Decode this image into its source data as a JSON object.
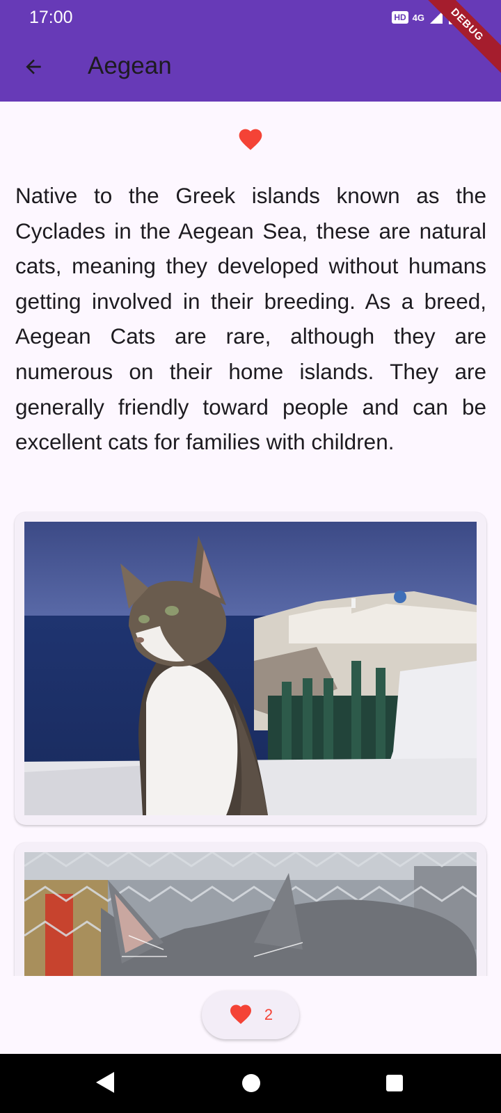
{
  "status_bar": {
    "time": "17:00",
    "hd_badge": "HD",
    "network": "4G"
  },
  "debug_banner": "DEBUG",
  "app_bar": {
    "title": "Aegean",
    "back_icon": "arrow-back-icon"
  },
  "favorite": {
    "icon": "heart-icon",
    "color": "#f44336"
  },
  "description": "Native to the Greek islands known as the Cyclades in the Aegean Sea, these are natural cats, meaning they developed without humans getting involved in their breeding. As a breed, Aegean Cats are rare, although they are numerous on their home islands. They are generally friendly toward people and can be excellent cats for families with children.",
  "images": [
    {
      "subject": "tabby and white cat sitting on a whitewashed rooftop overlooking the sea"
    },
    {
      "subject": "grey and white cat lying in front of a wire fence"
    }
  ],
  "fab": {
    "icon": "heart-icon",
    "count": "2"
  },
  "colors": {
    "app_bar": "#673ab7",
    "accent": "#f44336",
    "background": "#fdf7ff"
  }
}
